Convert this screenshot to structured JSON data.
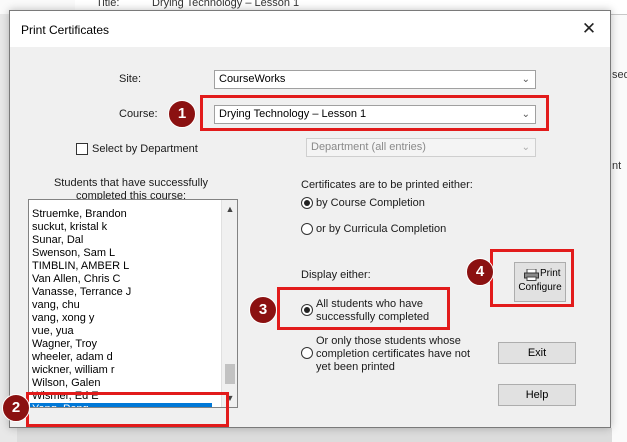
{
  "background": {
    "title_label": "Title:",
    "title_value": "Drying Technology – Lesson 1",
    "right_fragment_1": "sed",
    "right_fragment_2": "nt"
  },
  "dialog": {
    "title": "Print Certificates",
    "close_glyph": "✕"
  },
  "site": {
    "label": "Site:",
    "value": "CourseWorks"
  },
  "course": {
    "label": "Course:",
    "value": "Drying Technology – Lesson 1"
  },
  "department": {
    "checkbox_label": "Select by Department",
    "value": "Department (all entries)"
  },
  "students": {
    "caption_line1": "Students that have successfully",
    "caption_line2": "completed this course:",
    "items": [
      "Struemke, Brandon",
      "suckut, kristal k",
      "Sunar, Dal",
      "Swenson, Sam L",
      "TIMBLIN, AMBER L",
      "Van Allen, Chris C",
      "Vanasse, Terrance J",
      "vang, chu",
      "vang, xong y",
      "vue, yua",
      "Wagner, Troy",
      "wheeler, adam d",
      "wickner, william r",
      "Wilson, Galen",
      "Wismer, Ed E",
      "Yang, Peng"
    ],
    "selected": "Yang, Peng"
  },
  "certificates": {
    "caption": "Certificates are to be printed either:",
    "option1": "by Course Completion",
    "option2": "or by Curricula Completion"
  },
  "display": {
    "caption": "Display either:",
    "option1_line1": "All students who have",
    "option1_line2": "successfully completed",
    "option2_line1": "Or only those students whose",
    "option2_line2": "completion certificates have not",
    "option2_line3": "yet been printed"
  },
  "buttons": {
    "print_line1": "Print",
    "print_line2": "Configure",
    "exit": "Exit",
    "help": "Help"
  },
  "annotations": {
    "badge1": "1",
    "badge2": "2",
    "badge3": "3",
    "badge4": "4"
  },
  "colors": {
    "highlight": "#e21b1b",
    "badge": "#8b1111",
    "selection": "#0078d7"
  }
}
